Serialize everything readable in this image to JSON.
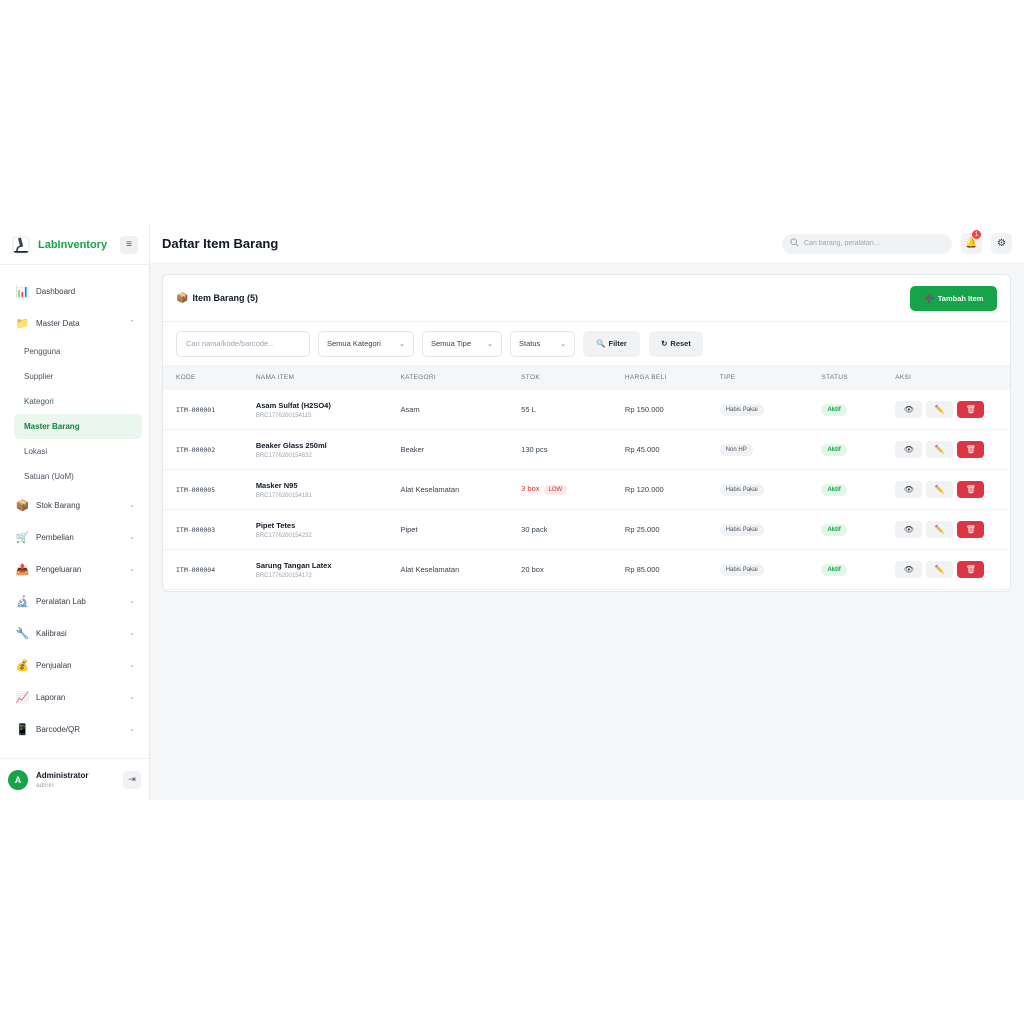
{
  "brand": {
    "name": "LabInventory",
    "logo_icon": "microscope-icon"
  },
  "sidebar": {
    "items": [
      {
        "label": "Dashboard",
        "icon": "bar-chart-icon",
        "glyph": "📊",
        "chevron": ""
      },
      {
        "label": "Master Data",
        "icon": "folder-icon",
        "glyph": "📁",
        "chevron": "⌃"
      },
      {
        "label": "Stok Barang",
        "icon": "box-icon",
        "glyph": "📦",
        "chevron": "⌄"
      },
      {
        "label": "Pembelian",
        "icon": "cart-icon",
        "glyph": "🛒",
        "chevron": "⌄"
      },
      {
        "label": "Pengeluaran",
        "icon": "outbox-icon",
        "glyph": "📤",
        "chevron": "⌄"
      },
      {
        "label": "Peralatan Lab",
        "icon": "microscope-icon",
        "glyph": "🔬",
        "chevron": "⌄"
      },
      {
        "label": "Kalibrasi",
        "icon": "tool-icon",
        "glyph": "🔧",
        "chevron": "⌄"
      },
      {
        "label": "Penjualan",
        "icon": "money-bag-icon",
        "glyph": "💰",
        "chevron": "⌄"
      },
      {
        "label": "Laporan",
        "icon": "chart-up-icon",
        "glyph": "📈",
        "chevron": "⌄"
      },
      {
        "label": "Barcode/QR",
        "icon": "phone-icon",
        "glyph": "📱",
        "chevron": "⌄"
      }
    ],
    "sub_items": [
      {
        "label": "Pengguna"
      },
      {
        "label": "Supplier"
      },
      {
        "label": "Kategori"
      },
      {
        "label": "Master Barang",
        "active": true
      },
      {
        "label": "Lokasi"
      },
      {
        "label": "Satuan (UoM)"
      }
    ]
  },
  "user": {
    "initial": "A",
    "name": "Administrator",
    "role": "admin"
  },
  "header": {
    "title": "Daftar Item Barang",
    "search_placeholder": "Cari barang, peralatan...",
    "notification_count": "1"
  },
  "card": {
    "title": "Item Barang (5)",
    "add_button": "Tambah Item"
  },
  "filters": {
    "search_placeholder": "Cari nama/kode/barcode...",
    "kategori": "Semua Kategori",
    "tipe": "Semua Tipe",
    "status": "Status",
    "filter_button": "Filter",
    "reset_button": "Reset"
  },
  "table": {
    "headers": [
      "KODE",
      "NAMA ITEM",
      "KATEGORI",
      "STOK",
      "HARGA BELI",
      "TIPE",
      "STATUS",
      "AKSI"
    ],
    "rows": [
      {
        "kode": "ITM-000001",
        "nama": "Asam Sulfat (H2SO4)",
        "barcode": "BRC1776200154115",
        "kategori": "Asam",
        "stok": "55 L",
        "low": "",
        "harga": "Rp 150.000",
        "tipe": "Habis Pakai",
        "status": "Aktif"
      },
      {
        "kode": "ITM-000002",
        "nama": "Beaker Glass 250ml",
        "barcode": "BRC1776200154632",
        "kategori": "Beaker",
        "stok": "130 pcs",
        "low": "",
        "harga": "Rp 45.000",
        "tipe": "Non HP",
        "status": "Aktif"
      },
      {
        "kode": "ITM-000005",
        "nama": "Masker N95",
        "barcode": "BRC1776200154181",
        "kategori": "Alat Keselamatan",
        "stok": "3 box",
        "low": "LOW",
        "harga": "Rp 120.000",
        "tipe": "Habis Pakai",
        "status": "Aktif"
      },
      {
        "kode": "ITM-000003",
        "nama": "Pipet Tetes",
        "barcode": "BRC1776200154232",
        "kategori": "Pipet",
        "stok": "30 pack",
        "low": "",
        "harga": "Rp 25.000",
        "tipe": "Habis Pakai",
        "status": "Aktif"
      },
      {
        "kode": "ITM-000004",
        "nama": "Sarung Tangan Latex",
        "barcode": "BRC1776200154172",
        "kategori": "Alat Keselamatan",
        "stok": "20 box",
        "low": "",
        "harga": "Rp 85.000",
        "tipe": "Habis Pakai",
        "status": "Aktif"
      }
    ]
  },
  "colors": {
    "brand": "#16a34a",
    "danger": "#dc3545",
    "active_bg": "#e9f7ee"
  }
}
